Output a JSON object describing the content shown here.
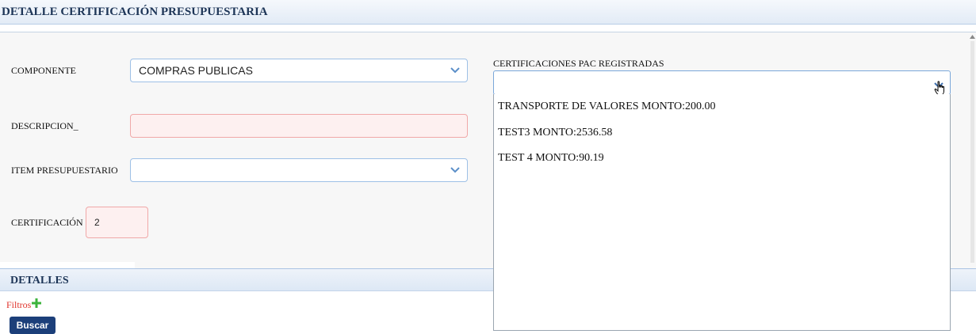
{
  "header": {
    "title": "DETALLE CERTIFICACIÓN PRESUPUESTARIA"
  },
  "form": {
    "componente": {
      "label": "COMPONENTE",
      "value": "COMPRAS PUBLICAS"
    },
    "descripcion": {
      "label": "DESCRIPCION_",
      "value": ""
    },
    "item": {
      "label": "ITEM PRESUPUESTARIO",
      "value": ""
    },
    "certificacion": {
      "label": "CERTIFICACIÓN",
      "value": "2"
    },
    "pac": {
      "label": "CERTIFICACIONES PAC REGISTRADAS",
      "value": "",
      "options": [
        "TRANSPORTE DE VALORES MONTO:200.00",
        "TEST3 MONTO:2536.58",
        "TEST 4 MONTO:90.19"
      ]
    }
  },
  "detalles": {
    "title": "DETALLES",
    "filtros_label": "Filtros",
    "buscar_label": "Buscar"
  },
  "icons": {
    "dropdown": "chevron-down-icon",
    "add": "plus-icon",
    "cursor": "hand-pointer-icon"
  },
  "colors": {
    "accent": "#1c3f7a",
    "error_border": "#f0a8a8",
    "error_bg": "#fdf0f0",
    "filtros": "#e0332b",
    "plus": "#3cb43c"
  }
}
